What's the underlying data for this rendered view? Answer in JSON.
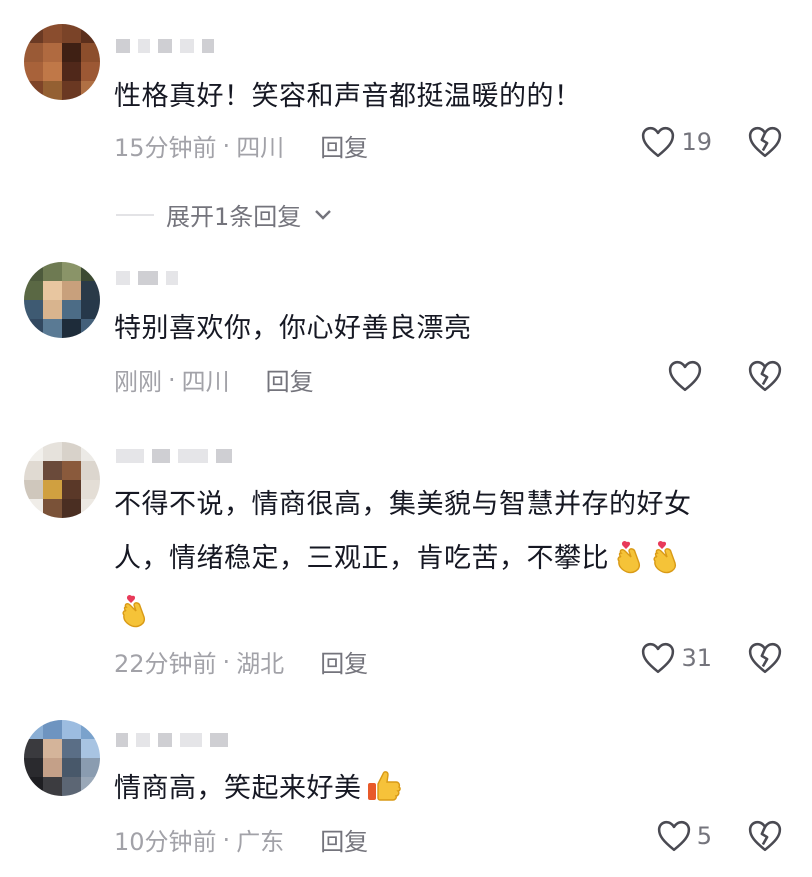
{
  "comments": [
    {
      "text": "性格真好！笑容和声音都挺温暖的的！",
      "time": "15分钟前",
      "location": "四川",
      "reply_label": "回复",
      "likes": "19",
      "expand_label": "展开1条回复"
    },
    {
      "text": "特别喜欢你，你心好善良漂亮",
      "time": "刚刚",
      "location": "四川",
      "reply_label": "回复",
      "likes": ""
    },
    {
      "text_line1": "不得不说，情商很高，集美貌与智慧并存的好女",
      "text_line2": "人，情绪稳定，三观正，肯吃苦，不攀比",
      "time": "22分钟前",
      "location": "湖北",
      "reply_label": "回复",
      "likes": "31"
    },
    {
      "text": "情商高，笑起来好美",
      "time": "10分钟前",
      "location": "广东",
      "reply_label": "回复",
      "likes": "5"
    }
  ],
  "meta_separator": "·",
  "icons": {
    "like": "heart-outline-icon",
    "dislike": "broken-heart-icon",
    "expand": "chevron-down-icon",
    "finger_heart": "finger-heart-emoji",
    "thumbs_up": "thumbs-up-emoji"
  }
}
